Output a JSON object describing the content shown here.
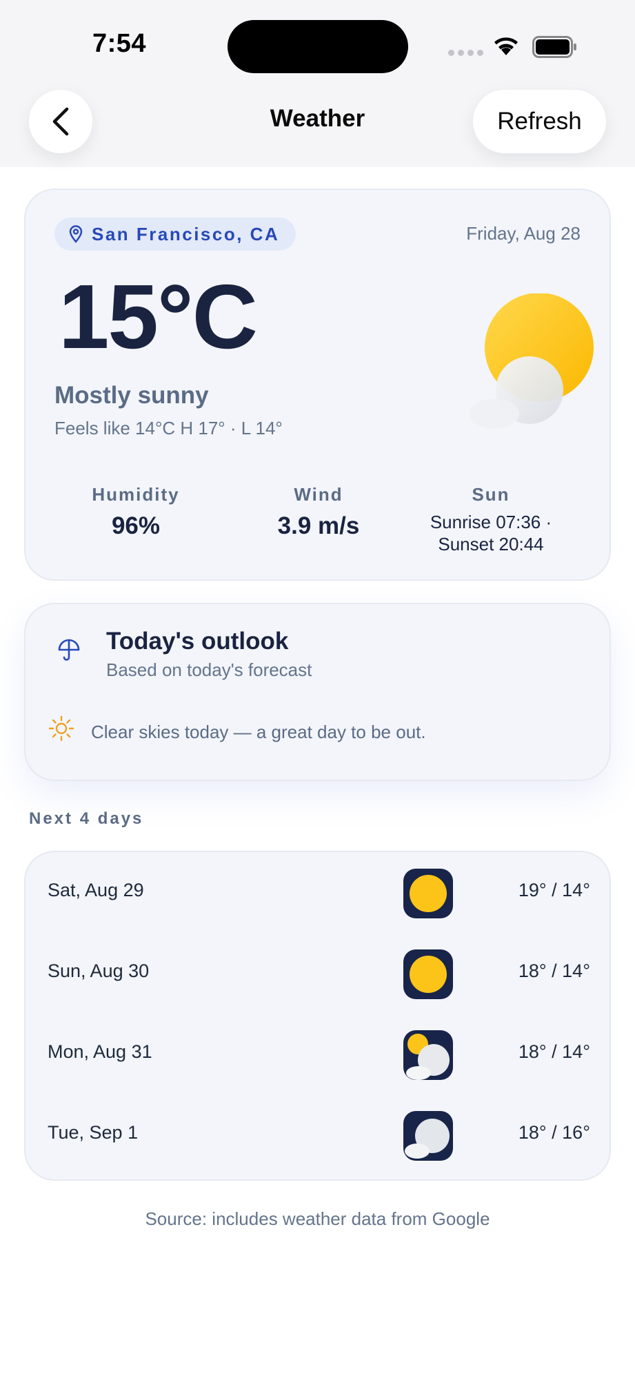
{
  "status_bar": {
    "time": "7:54"
  },
  "nav": {
    "title": "Weather",
    "refresh_label": "Refresh"
  },
  "current": {
    "location": "San Francisco, CA",
    "date": "Friday, Aug 28",
    "temperature": "15°C",
    "condition": "Mostly sunny",
    "feels_line": "Feels like 14°C  H 17°  ·  L 14°",
    "icon": "sun-behind-cloud-icon",
    "stats": {
      "humidity": {
        "label": "Humidity",
        "value": "96%"
      },
      "wind": {
        "label": "Wind",
        "value": "3.9 m/s"
      },
      "sun": {
        "label": "Sun",
        "sunrise": "Sunrise 07:36 ·",
        "sunset": "Sunset 20:44"
      }
    }
  },
  "outlook": {
    "title": "Today's outlook",
    "subtitle": "Based on today's forecast",
    "message": "Clear skies today — a great day to be out."
  },
  "forecast": {
    "section_label": "Next 4 days",
    "days": [
      {
        "day": "Sat, Aug 29",
        "temps": "19° / 14°",
        "icon": "sun-icon"
      },
      {
        "day": "Sun, Aug 30",
        "temps": "18° / 14°",
        "icon": "sun-icon"
      },
      {
        "day": "Mon, Aug 31",
        "temps": "18° / 14°",
        "icon": "partly-cloudy-icon"
      },
      {
        "day": "Tue, Sep 1",
        "temps": "18° / 16°",
        "icon": "cloud-icon"
      }
    ]
  },
  "source": "Source: includes weather data from Google",
  "colors": {
    "accent": "#2849b8",
    "sun": "#fcc419",
    "icon_bg": "#182449",
    "card_bg": "#f3f5fa"
  }
}
